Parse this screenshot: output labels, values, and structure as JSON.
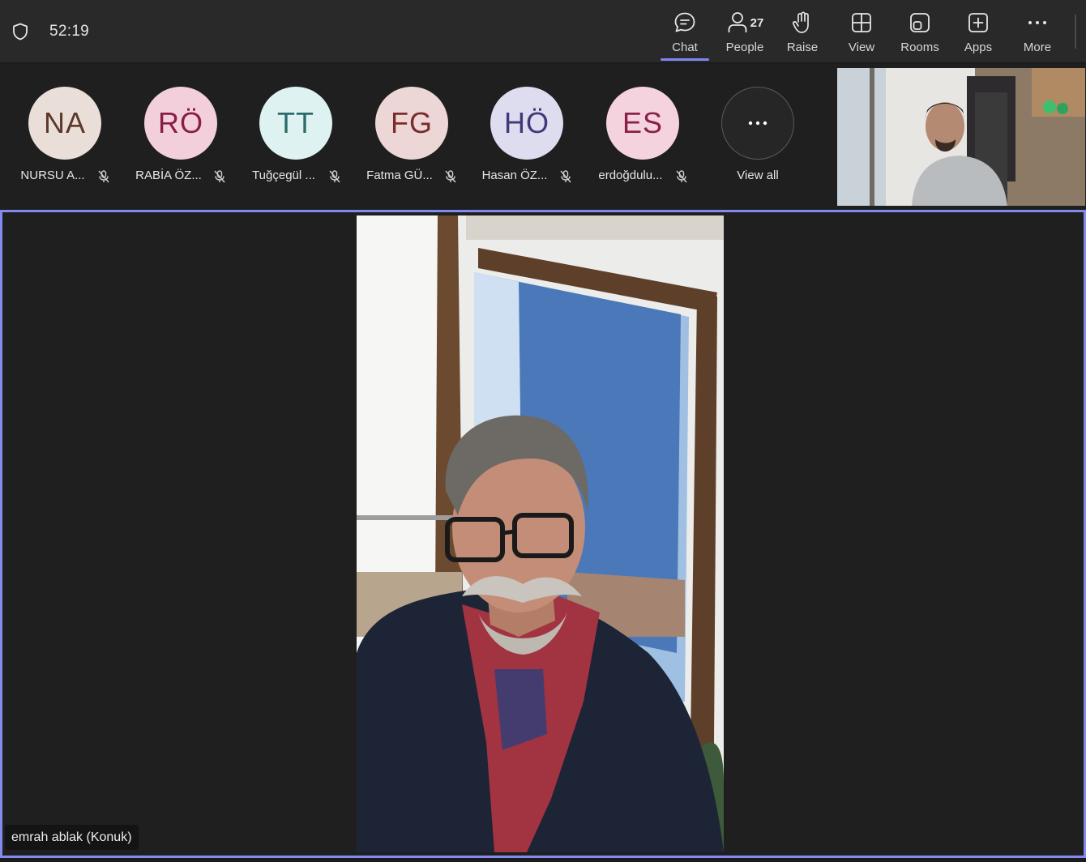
{
  "header": {
    "timer": "52:19",
    "buttons": {
      "chat": "Chat",
      "people": "People",
      "people_count": "27",
      "raise": "Raise",
      "view": "View",
      "rooms": "Rooms",
      "apps": "Apps",
      "more": "More"
    }
  },
  "participants": [
    {
      "initials": "NA",
      "name": "NURSU A...",
      "bg": "#eadfd8",
      "fg": "#5a3a2a"
    },
    {
      "initials": "RÖ",
      "name": "RABİA ÖZ...",
      "bg": "#f3cfdb",
      "fg": "#8a1d45"
    },
    {
      "initials": "TT",
      "name": "Tuğçegül ...",
      "bg": "#dff2f2",
      "fg": "#2c6b6b"
    },
    {
      "initials": "FG",
      "name": "Fatma GÜ...",
      "bg": "#edd6d6",
      "fg": "#7a2b2b"
    },
    {
      "initials": "HÖ",
      "name": "Hasan ÖZ...",
      "bg": "#dedcef",
      "fg": "#3d3a7a"
    },
    {
      "initials": "ES",
      "name": "erdoğdulu...",
      "bg": "#f4d3de",
      "fg": "#8c1f4a"
    }
  ],
  "view_all": {
    "label": "View all"
  },
  "speaker": {
    "name": "emrah ablak (Konuk)"
  },
  "colors": {
    "accent": "#7f85f5",
    "stage_border": "#8289ef"
  }
}
